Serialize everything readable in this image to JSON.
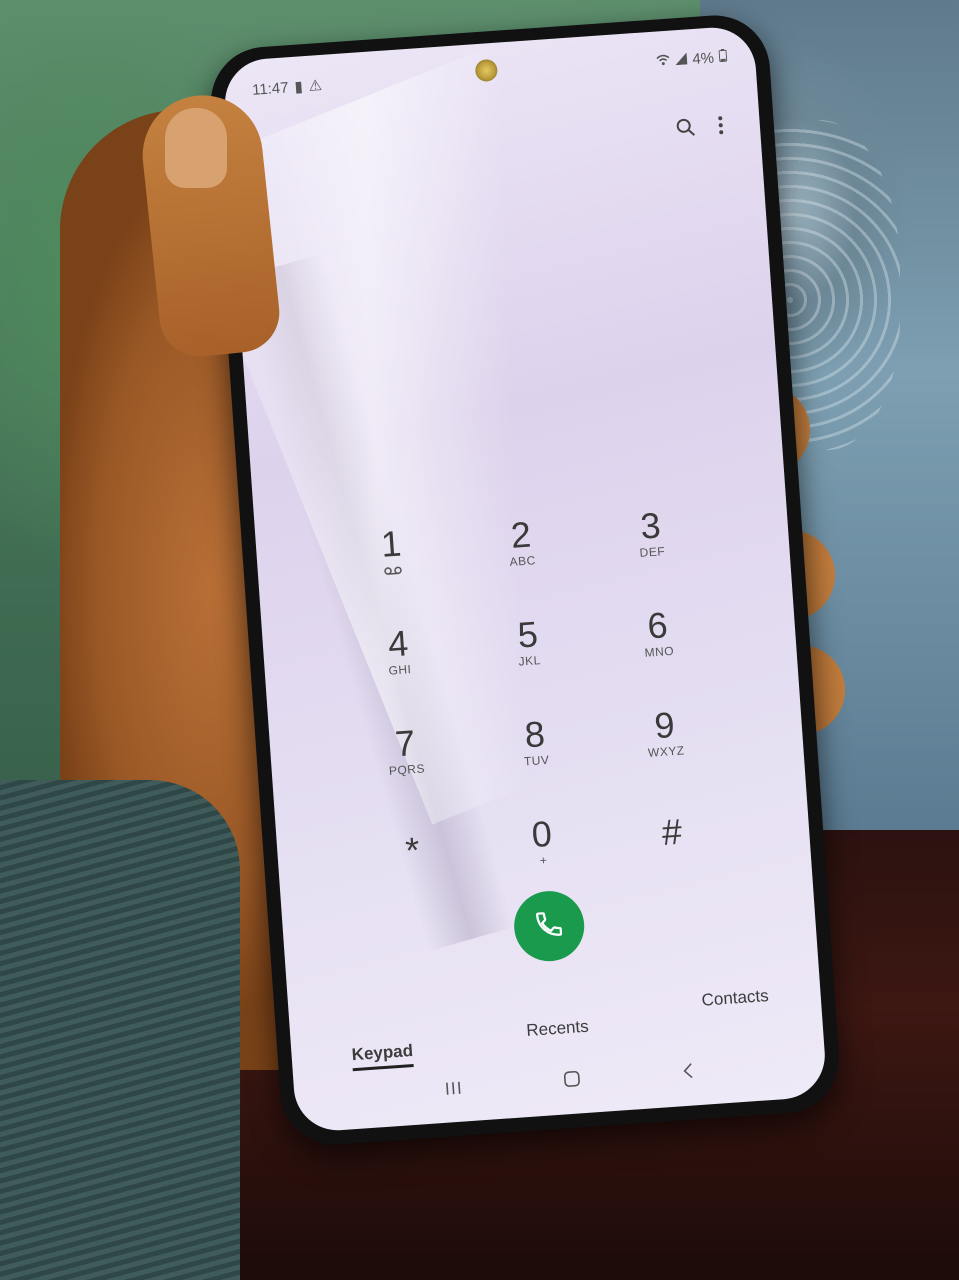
{
  "status_bar": {
    "time": "11:47",
    "battery": "4%",
    "left_icons": [
      "battery-low-icon",
      "warning-icon"
    ],
    "right_icons": [
      "wifi-icon",
      "signal-icon",
      "battery-icon"
    ]
  },
  "toolbar": {
    "icons": [
      "search-icon",
      "more-options-icon"
    ]
  },
  "keypad": {
    "keys": [
      {
        "digit": "1",
        "letters": "",
        "sub_icon": "voicemail-icon"
      },
      {
        "digit": "2",
        "letters": "ABC"
      },
      {
        "digit": "3",
        "letters": "DEF"
      },
      {
        "digit": "4",
        "letters": "GHI"
      },
      {
        "digit": "5",
        "letters": "JKL"
      },
      {
        "digit": "6",
        "letters": "MNO"
      },
      {
        "digit": "7",
        "letters": "PQRS"
      },
      {
        "digit": "8",
        "letters": "TUV"
      },
      {
        "digit": "9",
        "letters": "WXYZ"
      },
      {
        "digit": "*",
        "letters": ""
      },
      {
        "digit": "0",
        "letters": "+"
      },
      {
        "digit": "#",
        "letters": ""
      }
    ]
  },
  "call": {
    "icon": "phone-icon",
    "color": "#199a4c"
  },
  "tabs": [
    {
      "label": "Keypad",
      "active": true
    },
    {
      "label": "Recents",
      "active": false
    },
    {
      "label": "Contacts",
      "active": false
    }
  ],
  "navbar": {
    "icons": [
      "recent-apps-icon",
      "home-icon",
      "back-icon"
    ]
  }
}
